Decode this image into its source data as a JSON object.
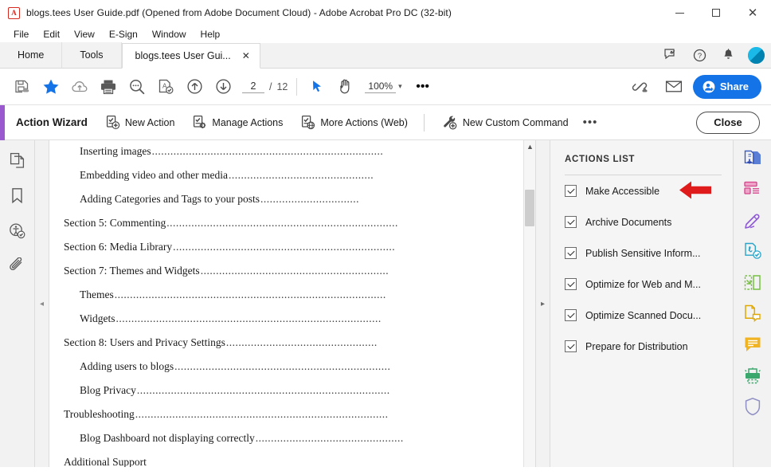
{
  "window": {
    "title": "blogs.tees User Guide.pdf (Opened from Adobe Document Cloud) - Adobe Acrobat Pro DC (32-bit)",
    "app_icon": "acrobat-logo-icon",
    "minimize": "–",
    "maximize": "□",
    "close": "✕"
  },
  "menubar": {
    "items": [
      {
        "label": "File"
      },
      {
        "label": "Edit"
      },
      {
        "label": "View"
      },
      {
        "label": "E-Sign"
      },
      {
        "label": "Window"
      },
      {
        "label": "Help"
      }
    ]
  },
  "tabs": {
    "home": "Home",
    "tools": "Tools",
    "document": "blogs.tees User Gui...",
    "document_close": "✕",
    "right_icons": [
      "feedback-icon",
      "help-icon",
      "notification-bell-icon",
      "user-avatar"
    ]
  },
  "toolbar": {
    "icons": [
      "save-to-cloud-icon",
      "star-icon",
      "upload-to-cloud-icon",
      "print-icon",
      "search-icon",
      "accessibility-check-icon",
      "previous-page-icon",
      "next-page-icon"
    ],
    "page_current": "2",
    "page_separator": "/",
    "page_total": "12",
    "select_tool": "select-cursor-icon",
    "hand_tool": "hand-tool-icon",
    "zoom_level": "100%",
    "zoom_caret": "▾",
    "more_tools": "•••",
    "link_icon": "share-link-icon",
    "email_icon": "email-icon",
    "share_label": "Share",
    "share_icon": "add-person-icon",
    "share_color": "#1473e6"
  },
  "action_wizard": {
    "accent_color": "#9b59d0",
    "title": "Action Wizard",
    "commands": [
      {
        "label": "New Action",
        "icon": "new-action-icon"
      },
      {
        "label": "Manage Actions",
        "icon": "manage-actions-icon"
      },
      {
        "label": "More Actions (Web)",
        "icon": "more-actions-web-icon"
      },
      {
        "label": "New Custom Command",
        "icon": "new-custom-command-icon"
      }
    ],
    "overflow": "•••",
    "close_label": "Close"
  },
  "left_rail": {
    "icons": [
      "page-thumbnails-icon",
      "bookmarks-icon",
      "accessibility-tags-icon",
      "attachments-icon"
    ],
    "collapse_arrow": "◂"
  },
  "document": {
    "toc": [
      {
        "text": "Inserting images",
        "indent": 1,
        "dots": "..........................................................................."
      },
      {
        "text": "Embedding video and other media",
        "indent": 1,
        "dots": "..............................................."
      },
      {
        "text": "Adding Categories and Tags to your posts",
        "indent": 1,
        "dots": "................................"
      },
      {
        "text": "Section 5: Commenting",
        "indent": 0,
        "dots": "..........................................................................."
      },
      {
        "text": "Section 6: Media Library ",
        "indent": 0,
        "dots": "........................................................................"
      },
      {
        "text": "Section 7: Themes and Widgets",
        "indent": 0,
        "dots": "............................................................."
      },
      {
        "text": "Themes",
        "indent": 1,
        "dots": "........................................................................................"
      },
      {
        "text": "Widgets ",
        "indent": 1,
        "dots": "......................................................................................"
      },
      {
        "text": "Section 8: Users and Privacy Settings ",
        "indent": 0,
        "dots": "................................................."
      },
      {
        "text": "Adding users to blogs",
        "indent": 1,
        "dots": "......................................................................"
      },
      {
        "text": "Blog Privacy",
        "indent": 1,
        "dots": ".................................................................................."
      },
      {
        "text": "Troubleshooting",
        "indent": 0,
        "dots": ".................................................................................."
      },
      {
        "text": "Blog Dashboard not displaying correctly ",
        "indent": 1,
        "dots": "................................................"
      },
      {
        "text": "Additional Support",
        "indent": 0,
        "dots": ""
      }
    ],
    "scroll_up_arrow": "▲",
    "expand_arrow": "▸"
  },
  "actions_list": {
    "title": "ACTIONS LIST",
    "items": [
      {
        "label": "Make Accessible",
        "checked": true,
        "annotated": true
      },
      {
        "label": "Archive Documents",
        "checked": true,
        "annotated": false
      },
      {
        "label": "Publish Sensitive Inform...",
        "checked": true,
        "annotated": false
      },
      {
        "label": "Optimize for Web and M...",
        "checked": true,
        "annotated": false
      },
      {
        "label": "Optimize Scanned Docu...",
        "checked": true,
        "annotated": false
      },
      {
        "label": "Prepare for Distribution",
        "checked": true,
        "annotated": false
      }
    ],
    "annotation_color": "#e01b1b",
    "annotation_name": "red-pointer-arrow"
  },
  "right_rail": {
    "icons": [
      {
        "name": "export-pdf-icon",
        "color": "#3f6cd4"
      },
      {
        "name": "create-pdf-icon",
        "color": "#e0559b"
      },
      {
        "name": "edit-pdf-icon",
        "color": "#8f5ad6"
      },
      {
        "name": "fill-and-sign-icon",
        "color": "#2aa4c9"
      },
      {
        "name": "combine-files-icon",
        "color": "#76c043"
      },
      {
        "name": "organize-pages-icon",
        "color": "#e0a800"
      },
      {
        "name": "comment-icon",
        "color": "#f0b323"
      },
      {
        "name": "scan-and-ocr-icon",
        "color": "#3aa86d"
      },
      {
        "name": "protect-icon",
        "color": "#8f8fc4"
      }
    ]
  }
}
